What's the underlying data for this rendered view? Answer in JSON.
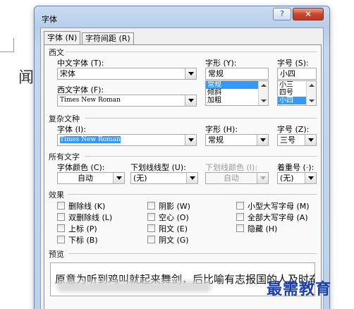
{
  "background": {
    "char": "闻"
  },
  "dialog": {
    "title": "字体",
    "help_label": "?",
    "close_label": "✕"
  },
  "tabs": [
    {
      "label": "字体 (N)",
      "active": true
    },
    {
      "label": "字符间距 (R)",
      "active": false
    }
  ],
  "western": {
    "group_label": "西文",
    "cn_font_label": "中文字体 (T):",
    "cn_font_value": "宋体",
    "west_font_label": "西文字体 (F):",
    "west_font_value": "Times New Roman",
    "style_label": "字形 (Y):",
    "style_value": "常规",
    "style_options": [
      "常规",
      "倾斜",
      "加粗"
    ],
    "style_selected": "常规",
    "size_label": "字号 (S):",
    "size_value": "小四",
    "size_options": [
      "小三",
      "四号",
      "小四"
    ],
    "size_selected": "小四"
  },
  "complex": {
    "group_label": "复杂文种",
    "font_label": "字体 (I):",
    "font_value": "Times New Roman",
    "style_label": "字形 (H):",
    "style_value": "常规",
    "size_label": "字号 (Z):",
    "size_value": "三号"
  },
  "all_text": {
    "group_label": "所有文字",
    "color_label": "字体颜色 (C):",
    "color_value": "自动",
    "underline_label": "下划线线型 (U):",
    "underline_value": "(无)",
    "underline_color_label": "下划线颜色 (I):",
    "underline_color_value": "自动",
    "emphasis_label": "着重号 (·):",
    "emphasis_value": "(无)"
  },
  "effects": {
    "group_label": "效果",
    "items": [
      {
        "label": "删除线 (K)"
      },
      {
        "label": "双删除线 (L)"
      },
      {
        "label": "上标 (P)"
      },
      {
        "label": "下标 (B)"
      },
      {
        "label": "阴影 (W)"
      },
      {
        "label": "空心 (O)"
      },
      {
        "label": "阳文 (E)"
      },
      {
        "label": "阴文 (G)"
      },
      {
        "label": "小型大写字母 (M)"
      },
      {
        "label": "全部大写字母 (A)"
      },
      {
        "label": "隐藏 (H)"
      }
    ]
  },
  "preview": {
    "group_label": "预览",
    "text": "原意为听到鸡叫就起来舞剑，后比喻有志报国的人及时奋"
  },
  "watermark": "最需教育"
}
